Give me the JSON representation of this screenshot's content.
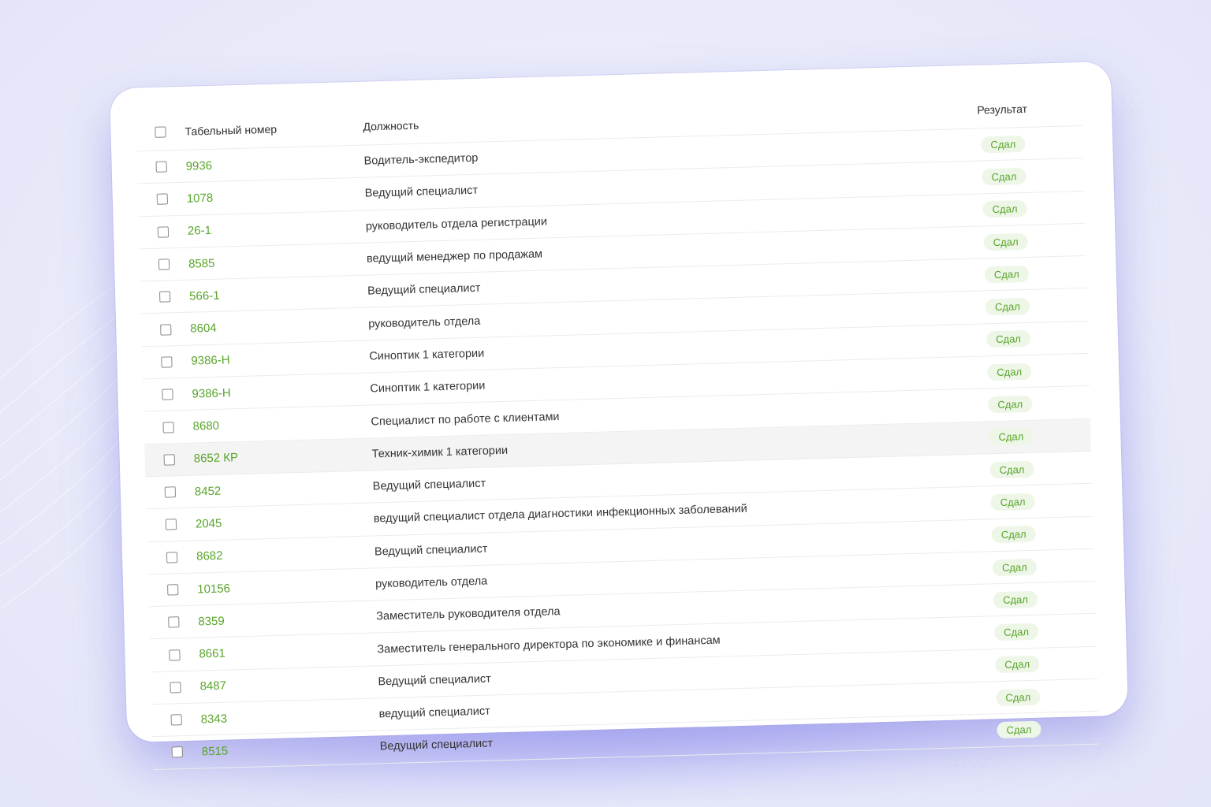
{
  "table": {
    "headers": {
      "number": "Табельный номер",
      "position": "Должность",
      "result": "Результат"
    },
    "rows": [
      {
        "number": "9936",
        "position": "Водитель-экспедитор",
        "result": "Сдал"
      },
      {
        "number": "1078",
        "position": "Ведущий специалист",
        "result": "Сдал"
      },
      {
        "number": "26-1",
        "position": "руководитель отдела регистрации",
        "result": "Сдал"
      },
      {
        "number": "8585",
        "position": "ведущий менеджер по продажам",
        "result": "Сдал"
      },
      {
        "number": "566-1",
        "position": "Ведущий специалист",
        "result": "Сдал"
      },
      {
        "number": "8604",
        "position": "руководитель отдела",
        "result": "Сдал"
      },
      {
        "number": "9386-Н",
        "position": "Синоптик 1 категории",
        "result": "Сдал"
      },
      {
        "number": "9386-Н",
        "position": "Синоптик 1 категории",
        "result": "Сдал"
      },
      {
        "number": "8680",
        "position": "Специалист по работе с клиентами",
        "result": "Сдал"
      },
      {
        "number": "8652 КР",
        "position": "Техник-химик 1 категории",
        "result": "Сдал",
        "highlighted": true
      },
      {
        "number": "8452",
        "position": "Ведущий специалист",
        "result": "Сдал"
      },
      {
        "number": "2045",
        "position": "ведущий специалист отдела диагностики инфекционных заболеваний",
        "result": "Сдал"
      },
      {
        "number": "8682",
        "position": "Ведущий специалист",
        "result": "Сдал"
      },
      {
        "number": "10156",
        "position": "руководитель отдела",
        "result": "Сдал"
      },
      {
        "number": "8359",
        "position": "Заместитель руководителя отдела",
        "result": "Сдал"
      },
      {
        "number": "8661",
        "position": "Заместитель генерального директора по экономике и финансам",
        "result": "Сдал"
      },
      {
        "number": "8487",
        "position": "Ведущий специалист",
        "result": "Сдал"
      },
      {
        "number": "8343",
        "position": "ведущий специалист",
        "result": "Сдал"
      },
      {
        "number": "8515",
        "position": "Ведущий специалист",
        "result": "Сдал"
      }
    ]
  },
  "colors": {
    "accent_green": "#58a52a",
    "badge_bg": "#edf6e7",
    "glow": "#6e6cf0"
  }
}
